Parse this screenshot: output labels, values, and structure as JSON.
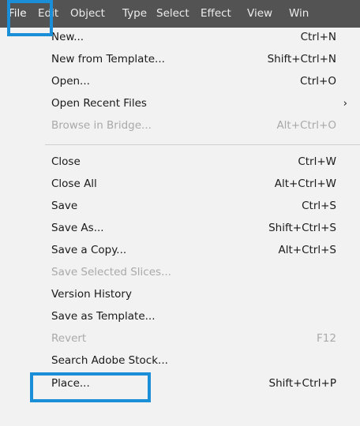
{
  "menubar": {
    "items": [
      {
        "label": "File"
      },
      {
        "label": "Edit"
      },
      {
        "label": "Object"
      },
      {
        "label": "Type"
      },
      {
        "label": "Select"
      },
      {
        "label": "Effect"
      },
      {
        "label": "View"
      },
      {
        "label": "Win"
      }
    ]
  },
  "file_menu": {
    "items": [
      {
        "label": "New...",
        "shortcut": "Ctrl+N"
      },
      {
        "label": "New from Template...",
        "shortcut": "Shift+Ctrl+N"
      },
      {
        "label": "Open...",
        "shortcut": "Ctrl+O"
      },
      {
        "label": "Open Recent Files",
        "shortcut": "",
        "submenu_arrow": "›"
      },
      {
        "label": "Browse in Bridge...",
        "shortcut": "Alt+Ctrl+O",
        "disabled": true
      },
      {
        "label": "Close",
        "shortcut": "Ctrl+W"
      },
      {
        "label": "Close All",
        "shortcut": "Alt+Ctrl+W"
      },
      {
        "label": "Save",
        "shortcut": "Ctrl+S"
      },
      {
        "label": "Save As...",
        "shortcut": "Shift+Ctrl+S"
      },
      {
        "label": "Save a Copy...",
        "shortcut": "Alt+Ctrl+S"
      },
      {
        "label": "Save Selected Slices...",
        "shortcut": "",
        "disabled": true
      },
      {
        "label": "Version History",
        "shortcut": ""
      },
      {
        "label": "Save as Template...",
        "shortcut": ""
      },
      {
        "label": "Revert",
        "shortcut": "F12",
        "disabled": true
      },
      {
        "label": "Search Adobe Stock...",
        "shortcut": ""
      },
      {
        "label": "Place...",
        "shortcut": "Shift+Ctrl+P"
      }
    ]
  },
  "colors": {
    "menubar_bg": "#535353",
    "menu_bg": "#f2f2f2",
    "disabled_text": "#a9a9a9",
    "highlight_box": "#1a8fd8"
  }
}
